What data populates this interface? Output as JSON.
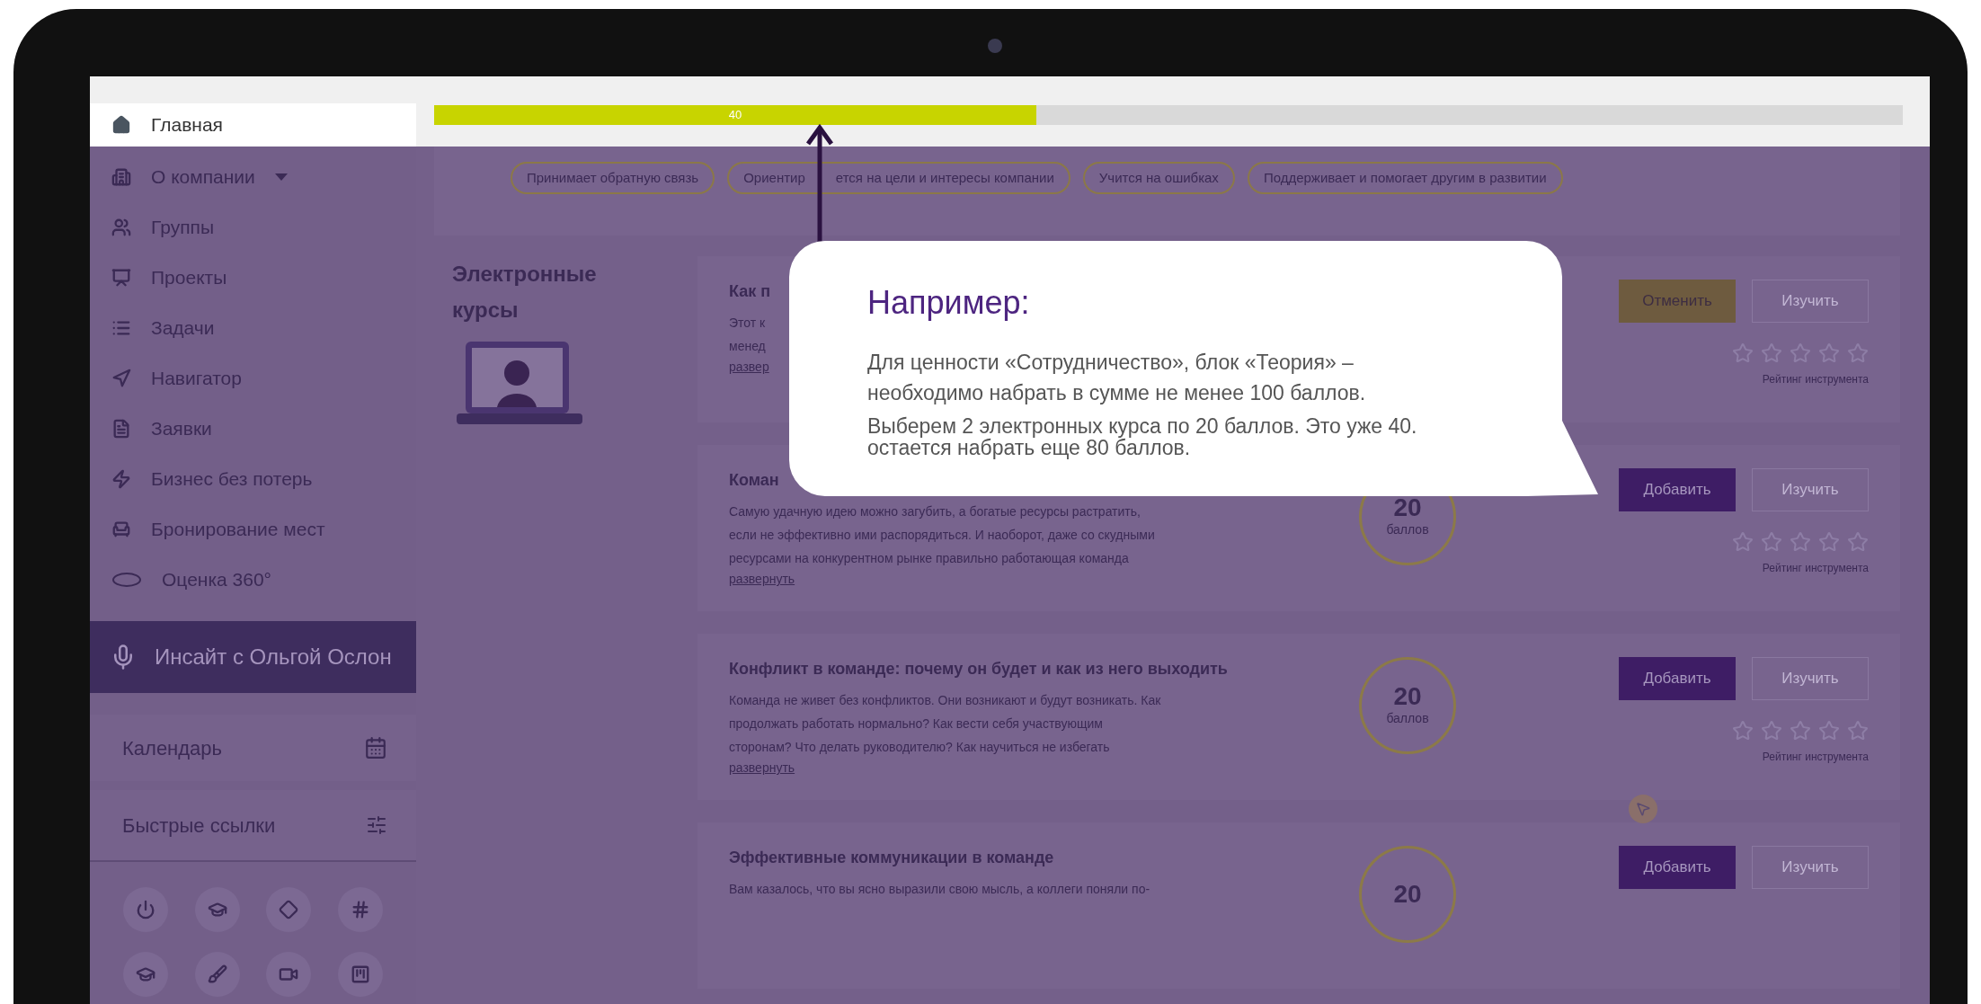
{
  "progress": {
    "level": 0.41,
    "label": "40"
  },
  "sidebar": {
    "items": [
      {
        "label": "Главная",
        "selected": true,
        "expandable": false
      },
      {
        "label": "О компании",
        "selected": false,
        "expandable": true
      },
      {
        "label": "Группы",
        "selected": false,
        "expandable": false
      },
      {
        "label": "Проекты",
        "selected": false,
        "expandable": false
      },
      {
        "label": "Задачи",
        "selected": false,
        "expandable": false
      },
      {
        "label": "Навигатор",
        "selected": false,
        "expandable": false
      },
      {
        "label": "Заявки",
        "selected": false,
        "expandable": false
      },
      {
        "label": "Бизнес без потерь",
        "selected": false,
        "expandable": false
      },
      {
        "label": "Бронирование мест",
        "selected": false,
        "expandable": false
      },
      {
        "label": "Оценка 360°",
        "selected": false,
        "expandable": false
      }
    ],
    "insight_button": {
      "label": "Инсайт с Ольгой Ослон"
    },
    "calendar": {
      "label": "Календарь"
    },
    "quick_links": {
      "label": "Быстрые ссылки"
    }
  },
  "tags": [
    {
      "parts": [
        "Принимает обратную связь"
      ]
    },
    {
      "parts": [
        "Ориентир",
        "ется на цели и интересы компании"
      ]
    },
    {
      "parts": [
        "Учится на ошибках"
      ]
    },
    {
      "parts": [
        "Поддерживает и помогает другим в развитии"
      ]
    }
  ],
  "section": {
    "title": "Электронные курсы"
  },
  "courses": [
    {
      "title": "Как п",
      "description_lines": [
        "Этот к",
        "менед"
      ],
      "expand_link": "развер",
      "actions": [
        {
          "kind": "cancel",
          "label": "Отменить"
        },
        {
          "kind": "outline",
          "label": "Изучить"
        }
      ],
      "stars": 0,
      "rating_label": "Рейтинг инструмента"
    },
    {
      "title": "Коман",
      "description_lines": [
        "Самую удачную идею можно загубить, а богатые ресурсы растратить,",
        "если не эффективно ими распорядиться. И наоборот, даже со скудными",
        "ресурсами на конкурентном рынке правильно работающая команда"
      ],
      "expand_link": "развернуть",
      "score": {
        "points": "20",
        "unit": "баллов"
      },
      "actions": [
        {
          "kind": "add",
          "label": "Добавить"
        },
        {
          "kind": "outline",
          "label": "Изучить"
        }
      ],
      "stars": 0,
      "rating_label": "Рейтинг инструмента"
    },
    {
      "title": "Конфликт в команде: почему он будет и как из него выходить",
      "description_lines": [
        "Команда не живет без конфликтов. Они возникают и будут возникать. Как",
        "продолжать работать нормально? Как вести себя участвующим",
        "сторонам? Что делать руководителю? Как научиться не избегать"
      ],
      "expand_link": "развернуть",
      "score": {
        "points": "20",
        "unit": "баллов"
      },
      "actions": [
        {
          "kind": "add",
          "label": "Добавить"
        },
        {
          "kind": "outline",
          "label": "Изучить"
        }
      ],
      "stars": 0,
      "rating_label": "Рейтинг инструмента"
    },
    {
      "title": "Эффективные коммуникации в команде",
      "description_lines": [
        "Вам казалось, что вы ясно выразили свою мысль, а коллеги поняли по-"
      ],
      "score": {
        "points": "20"
      },
      "actions": [
        {
          "kind": "add",
          "label": "Добавить"
        },
        {
          "kind": "outline",
          "label": "Изучить"
        }
      ]
    }
  ],
  "callout": {
    "title": "Например:",
    "paragraphs": [
      {
        "lines": [
          "Для ценности «Сотрудничество», блок «Теория» –",
          "необходимо набрать в сумме не менее 100 баллов."
        ]
      },
      {
        "lines": [
          "Выберем 2 электронных курса по 20 баллов. Это уже 40.",
          "остается набрать еще 80 баллов."
        ]
      }
    ]
  }
}
